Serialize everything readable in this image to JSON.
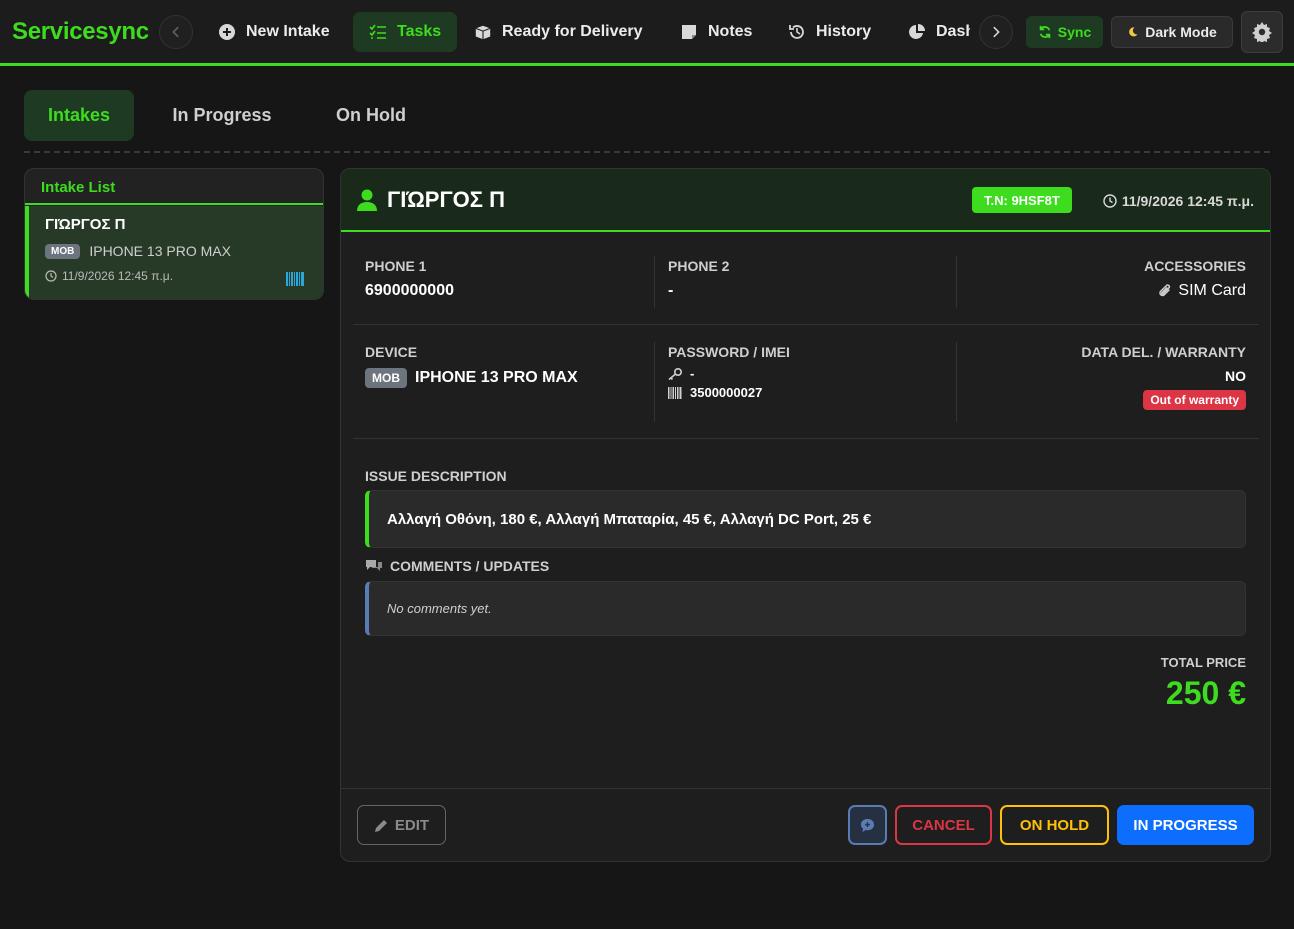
{
  "navbar": {
    "brand": "Servicesync",
    "items": [
      {
        "label": "New Intake",
        "icon": "plus-circle-icon",
        "active": false
      },
      {
        "label": "Tasks",
        "icon": "tasks-icon",
        "active": true
      },
      {
        "label": "Ready for Delivery",
        "icon": "box-icon",
        "active": false
      },
      {
        "label": "Notes",
        "icon": "note-icon",
        "active": false
      },
      {
        "label": "History",
        "icon": "history-icon",
        "active": false
      },
      {
        "label": "Dashboard",
        "icon": "pie-chart-icon",
        "active": false
      }
    ],
    "sync_label": "Sync",
    "dark_mode_label": "Dark Mode",
    "accent_color": "#3ddc1f"
  },
  "tabs": [
    {
      "label": "Intakes",
      "active": true
    },
    {
      "label": "In Progress",
      "active": false
    },
    {
      "label": "On Hold",
      "active": false
    }
  ],
  "intake_list": {
    "title": "Intake List",
    "items": [
      {
        "name": "ΓΙΏΡΓΟΣ Π",
        "device_type": "MOB",
        "device": "IPHONE 13 PRO MAX",
        "date": "11/9/2026 12:45 π.μ."
      }
    ]
  },
  "detail": {
    "name": "ΓΙΏΡΓΟΣ Π",
    "tn": "T.N: 9HSF8T",
    "date": "11/9/2026 12:45 π.μ.",
    "phone1_label": "PHONE 1",
    "phone1": "6900000000",
    "phone2_label": "PHONE 2",
    "phone2": "-",
    "accessories_label": "ACCESSORIES",
    "accessories": "SIM Card",
    "device_label": "DEVICE",
    "device_type": "MOB",
    "device": "IPHONE 13 PRO MAX",
    "password_label": "PASSWORD / IMEI",
    "password": "-",
    "imei": "3500000027",
    "warranty_label": "DATA DEL. / WARRANTY",
    "data_del": "NO",
    "warranty": "Out of warranty",
    "issue_label": "ISSUE DESCRIPTION",
    "issue": "Αλλαγή Οθόνη, 180 €, Αλλαγή Μπαταρία, 45 €, Αλλαγή DC Port, 25 €",
    "comments_label": "COMMENTS / UPDATES",
    "comments_empty": "No comments yet.",
    "total_label": "TOTAL PRICE",
    "total": "250 €"
  },
  "actions": {
    "edit": "EDIT",
    "cancel": "CANCEL",
    "on_hold": "ON HOLD",
    "in_progress": "IN PROGRESS"
  }
}
